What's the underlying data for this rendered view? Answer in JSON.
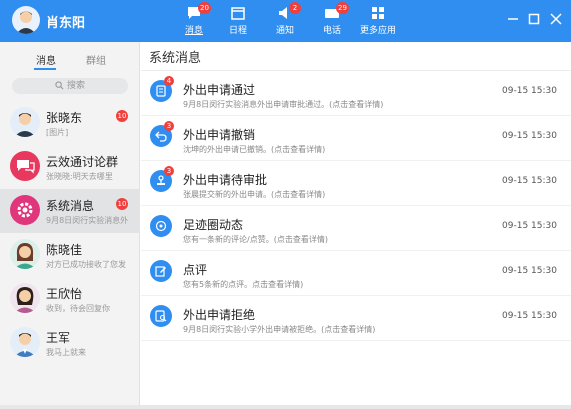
{
  "header": {
    "user_name": "肖东阳",
    "nav": [
      {
        "label": "消息",
        "badge": "20",
        "icon": "message-icon",
        "active": true
      },
      {
        "label": "日程",
        "badge": "",
        "icon": "calendar-icon",
        "active": false
      },
      {
        "label": "通知",
        "badge": "2",
        "icon": "notice-icon",
        "active": false
      },
      {
        "label": "电话",
        "badge": "29",
        "icon": "phone-icon",
        "active": false
      },
      {
        "label": "更多应用",
        "badge": "",
        "icon": "apps-icon",
        "active": false
      }
    ],
    "window_controls": [
      "minimize",
      "maximize",
      "close"
    ]
  },
  "sidebar": {
    "tabs": [
      "消息",
      "群组"
    ],
    "search_placeholder": "搜索",
    "contacts": [
      {
        "name": "张晓东",
        "preview": "[图片]",
        "badge": "10"
      },
      {
        "name": "云效通讨论群",
        "preview": "张晓晓:明天去哪里",
        "badge": ""
      },
      {
        "name": "系统消息",
        "preview": "9月8日闵行实验消息外",
        "badge": "10"
      },
      {
        "name": "陈晓佳",
        "preview": "对方已成功接收了您发",
        "badge": ""
      },
      {
        "name": "王欣怡",
        "preview": "收到，待会回复你",
        "badge": ""
      },
      {
        "name": "王军",
        "preview": "我马上就来",
        "badge": ""
      }
    ]
  },
  "main": {
    "title": "系统消息",
    "messages": [
      {
        "title": "外出申请通过",
        "desc": "9月8日闵行实验消息外出申请审批通过。(点击查看详情)",
        "time": "09-15  15:30",
        "badge": "4"
      },
      {
        "title": "外出申请撤销",
        "desc": "沈坤的外出申请已撤销。(点击查看详情)",
        "time": "09-15  15:30",
        "badge": "3"
      },
      {
        "title": "外出申请待审批",
        "desc": "张晨提交新的外出申请。(点击查看详情)",
        "time": "09-15  15:30",
        "badge": "3"
      },
      {
        "title": "足迹圈动态",
        "desc": "您有一条新的评论/点赞。(点击查看详情)",
        "time": "09-15  15:30",
        "badge": ""
      },
      {
        "title": "点评",
        "desc": "您有5条新的点评。点击查看详情)",
        "time": "09-15  15:30",
        "badge": ""
      },
      {
        "title": "外出申请拒绝",
        "desc": "9月8日闵行实验小学外出申请被拒绝。(点击查看详情)",
        "time": "09-15  15:30",
        "badge": ""
      }
    ]
  },
  "colors": {
    "accent": "#2f8ef0",
    "badge": "#f1403c",
    "sidebar": "#f3f3f4"
  }
}
